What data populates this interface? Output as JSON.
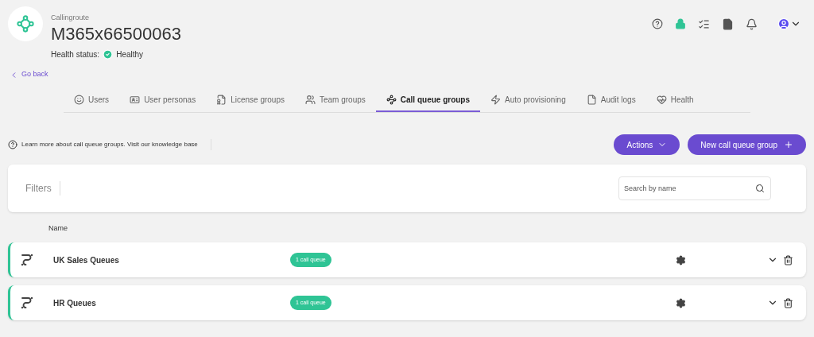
{
  "header": {
    "org_label": "Callingroute",
    "title": "M365x66500063",
    "health_label": "Health status:",
    "health_value": "Healthy"
  },
  "back_link": "Go back",
  "tabs": [
    {
      "label": "Users",
      "selected": false
    },
    {
      "label": "User personas",
      "selected": false
    },
    {
      "label": "License groups",
      "selected": false
    },
    {
      "label": "Team groups",
      "selected": false
    },
    {
      "label": "Call queue groups",
      "selected": true
    },
    {
      "label": "Auto provisioning",
      "selected": false
    },
    {
      "label": "Audit logs",
      "selected": false
    },
    {
      "label": "Health",
      "selected": false
    }
  ],
  "info": "Learn more about call queue groups. Visit our knowledge base",
  "buttons": {
    "actions": "Actions",
    "new": "New call queue group"
  },
  "filters": {
    "label": "Filters",
    "search_placeholder": "Search by name"
  },
  "table": {
    "column": "Name",
    "rows": [
      {
        "name": "UK Sales Queues",
        "badge": "1 call queue"
      },
      {
        "name": "HR Queues",
        "badge": "1 call queue"
      }
    ]
  }
}
